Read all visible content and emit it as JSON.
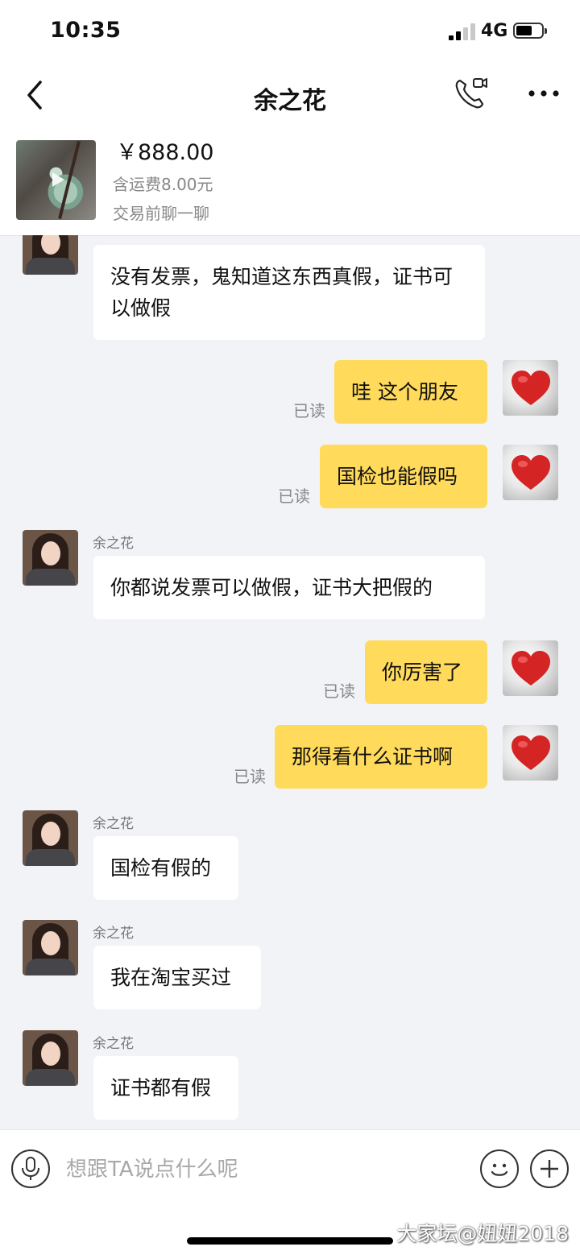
{
  "status_bar": {
    "time": "10:35",
    "network": "4G"
  },
  "header": {
    "title": "余之花",
    "back_icon": "chevron-left-icon",
    "call_icon": "phone-video-icon",
    "more_icon": "more-dots-icon"
  },
  "product": {
    "price": "￥888.00",
    "shipping": "含运费8.00元",
    "hint": "交易前聊一聊"
  },
  "messages": [
    {
      "side": "in",
      "text": "没有发票，鬼知道这东西真假，证书可以做假"
    },
    {
      "side": "out",
      "text": "哇 这个朋友",
      "read": "已读"
    },
    {
      "side": "out",
      "text": "国检也能假吗",
      "read": "已读"
    },
    {
      "side": "in",
      "sender": "余之花",
      "text": "你都说发票可以做假，证书大把假的"
    },
    {
      "side": "out",
      "text": "你厉害了",
      "read": "已读"
    },
    {
      "side": "out",
      "text": "那得看什么证书啊",
      "read": "已读"
    },
    {
      "side": "in",
      "sender": "余之花",
      "text": "国检有假的"
    },
    {
      "side": "in",
      "sender": "余之花",
      "text": "我在淘宝买过"
    },
    {
      "side": "in",
      "sender": "余之花",
      "text": "证书都有假"
    }
  ],
  "input": {
    "placeholder": "想跟TA说点什么呢"
  },
  "watermark": "大家坛@妞妞2018",
  "colors": {
    "outgoing_bubble": "#ffda5b",
    "incoming_bubble": "#ffffff",
    "background": "#f2f3f7"
  }
}
